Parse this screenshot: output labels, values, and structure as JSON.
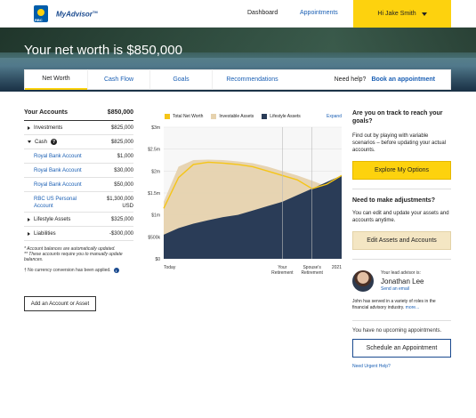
{
  "header": {
    "logo_text": "RBC",
    "brand": "MyAdvisor",
    "brand_tm": "TM",
    "nav": {
      "dashboard": "Dashboard",
      "appointments": "Appointments"
    },
    "user": "Hi Jake Smith"
  },
  "hero": {
    "title": "Your net worth is $850,000"
  },
  "subnav": {
    "tabs": [
      "Net Worth",
      "Cash Flow",
      "Goals",
      "Recommendations"
    ],
    "active": "Net Worth",
    "help_text": "Need help?",
    "help_link": "Book an appointment"
  },
  "accounts": {
    "title": "Your Accounts",
    "total": "$850,000",
    "rows": [
      {
        "label": "Investments",
        "value": "$825,000"
      },
      {
        "label": "Cash",
        "value": "$825,000"
      },
      {
        "label": "Royal Bank Account",
        "value": "$1,000"
      },
      {
        "label": "Royal Bank Account",
        "value": "$30,000"
      },
      {
        "label": "Royal Bank Account",
        "value": "$50,000"
      },
      {
        "label": "RBC US Personal Account",
        "value": "$1,300,000",
        "currency": "USD"
      },
      {
        "label": "Lifestyle Assets",
        "value": "$325,000"
      },
      {
        "label": "Liabilities",
        "value": "-$300,000"
      }
    ],
    "note1": "* Account balances are automatically updated.",
    "note1b": "** These accounts require you to manually update balances.",
    "note2": "† No currency conversion has been applied.",
    "add_button": "Add an Account or Asset"
  },
  "chart_data": {
    "type": "area",
    "legend": [
      "Total Net Worth",
      "Investable Assets",
      "Lifestyle Assets"
    ],
    "expand_label": "Expand",
    "y_ticks": [
      "$0",
      "$500k",
      "$1m",
      "$1.5m",
      "$2m",
      "$2.5m",
      "$3m"
    ],
    "ylim": [
      0,
      3000000
    ],
    "x_labels": [
      "Today",
      "Your Retirement",
      "Spouse's Retirement",
      "2021"
    ],
    "x": [
      0,
      1,
      2,
      3,
      4,
      5,
      6,
      7,
      8,
      9,
      10,
      11,
      12
    ],
    "series": [
      {
        "name": "Lifestyle Assets",
        "values": [
          550000,
          700000,
          800000,
          880000,
          950000,
          1000000,
          1100000,
          1200000,
          1300000,
          1450000,
          1600000,
          1750000,
          1900000
        ]
      },
      {
        "name": "Investable Assets",
        "values": [
          1300000,
          2100000,
          2250000,
          2260000,
          2250000,
          2220000,
          2180000,
          2100000,
          2000000,
          1900000,
          1780000,
          1650000,
          1450000
        ]
      },
      {
        "name": "Total Net Worth",
        "values": [
          1150000,
          1850000,
          2150000,
          2200000,
          2180000,
          2150000,
          2100000,
          2000000,
          1900000,
          1800000,
          1600000,
          1700000,
          1900000
        ]
      }
    ],
    "colors": {
      "total": "#f5c518",
      "investable": "#e6d2ae",
      "lifestyle": "#2a3c57"
    }
  },
  "right": {
    "q_title": "Are you on track to reach your goals?",
    "q_text": "Find out by playing with variable scenarios – before updating your actual accounts.",
    "explore_button": "Explore My Options",
    "adj_title": "Need to make adjustments?",
    "adj_text": "You can edit and update your assets and accounts anytime.",
    "edit_button": "Edit Assets and Accounts",
    "advisor_label": "Your lead advisor is:",
    "advisor_name": "Jonathan Lee",
    "advisor_email": "Send an email",
    "advisor_bio": "John has served in a variety of roles in the financial advisory industry.",
    "advisor_more": "more...",
    "appointments_text": "You have no upcoming appointments.",
    "schedule_button": "Schedule an Appointment",
    "urgent_link": "Need Urgent Help?"
  }
}
